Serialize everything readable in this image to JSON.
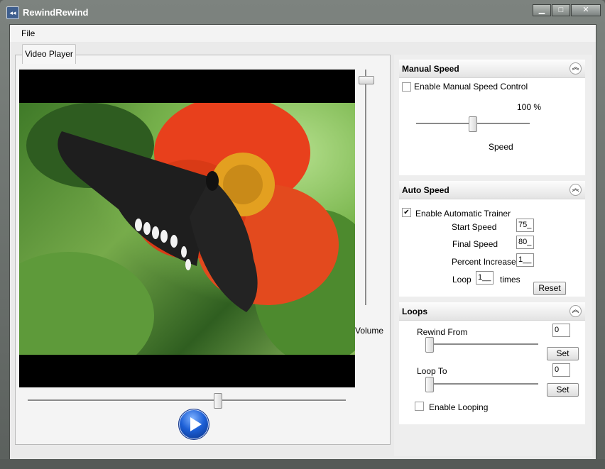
{
  "window": {
    "title": "RewindRewind",
    "icon": "app-rewind-icon"
  },
  "menu": {
    "file": "File"
  },
  "player": {
    "tab_label": "Video Player",
    "volume_label": "Volume",
    "volume_level": 0.97,
    "seek_position": 0.6
  },
  "manual_speed": {
    "title": "Manual Speed",
    "enable_label": "Enable Manual Speed Control",
    "enabled": false,
    "speed_value": "100 %",
    "speed_label": "Speed",
    "speed_level": 0.5
  },
  "auto_speed": {
    "title": "Auto Speed",
    "enable_label": "Enable Automatic Trainer",
    "enabled": true,
    "start_label": "Start Speed",
    "start_value": "75_",
    "final_label": "Final Speed",
    "final_value": "80_",
    "percent_label": "Percent Increase",
    "percent_value": "1__",
    "loop_label": "Loop",
    "loop_value": "1__",
    "times_label": "times",
    "reset_label": "Reset"
  },
  "loops": {
    "title": "Loops",
    "from_label": "Rewind From",
    "from_value": "0",
    "to_label": "Loop To",
    "to_value": "0",
    "set_label": "Set",
    "enable_label": "Enable Looping",
    "enabled": false
  },
  "colors": {
    "accent": "#1c5fd6",
    "flower": "#e8401c",
    "wing": "#1e1e1e"
  }
}
